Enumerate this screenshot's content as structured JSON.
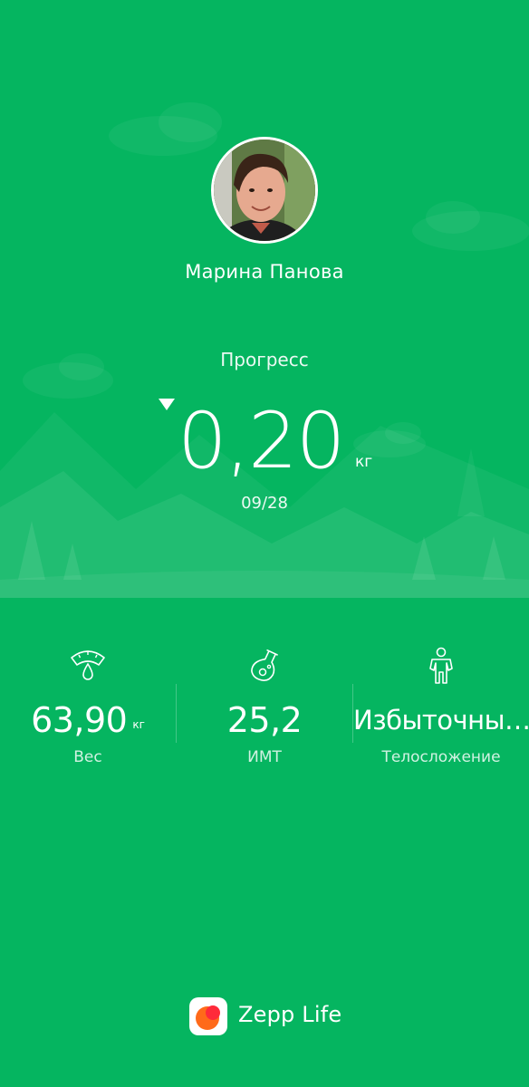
{
  "user": {
    "name": "Марина Панова"
  },
  "progress": {
    "label": "Прогресс",
    "value": "0,20",
    "unit": "кг",
    "date": "09/28",
    "trend": "down"
  },
  "stats": [
    {
      "value": "63,90",
      "unit": "кг",
      "label": "Вес",
      "icon": "scale-icon"
    },
    {
      "value": "25,2",
      "unit": "",
      "label": "ИМТ",
      "icon": "bmi-flask-icon"
    },
    {
      "value": "Избыточны…",
      "unit": "",
      "label": "Телосложение",
      "icon": "body-figure-icon"
    }
  ],
  "brand": {
    "name": "Zepp Life"
  },
  "colors": {
    "background": "#05b560",
    "foreground": "#ffffff",
    "logo_orange": "#ff6a1a",
    "logo_red": "#ff2a3a"
  }
}
